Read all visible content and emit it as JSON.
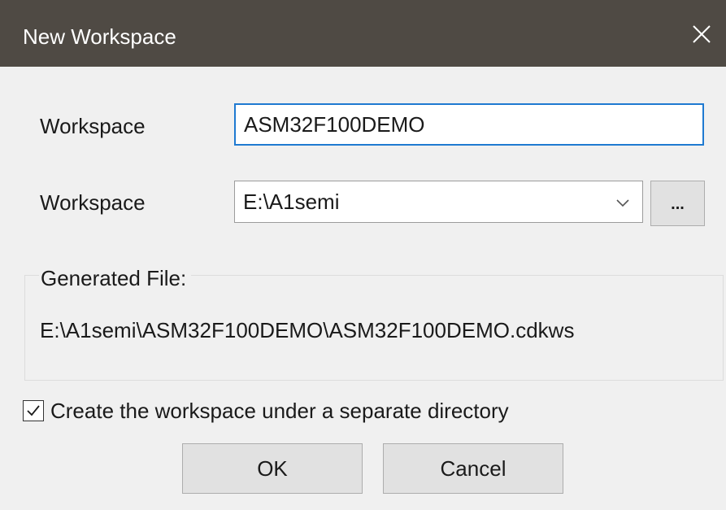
{
  "window": {
    "title": "New Workspace",
    "close_icon": "close-icon"
  },
  "form": {
    "workspace_name_label": "Workspace",
    "workspace_name_value": "ASM32F100DEMO",
    "workspace_dir_label": "Workspace",
    "workspace_dir_value": "E:\\A1semi",
    "browse_label": "...",
    "dropdown_icon": "chevron-down-icon"
  },
  "generated": {
    "legend": "Generated File:",
    "path": "E:\\A1semi\\ASM32F100DEMO\\ASM32F100DEMO.cdkws"
  },
  "options": {
    "separate_dir_label": "Create the workspace under a separate directory",
    "separate_dir_checked": true
  },
  "buttons": {
    "ok": "OK",
    "cancel": "Cancel"
  },
  "colors": {
    "titlebar": "#4f4a44",
    "dialog_bg": "#f0f0f0",
    "focus_border": "#1f7ad1",
    "button_bg": "#e1e1e1"
  }
}
